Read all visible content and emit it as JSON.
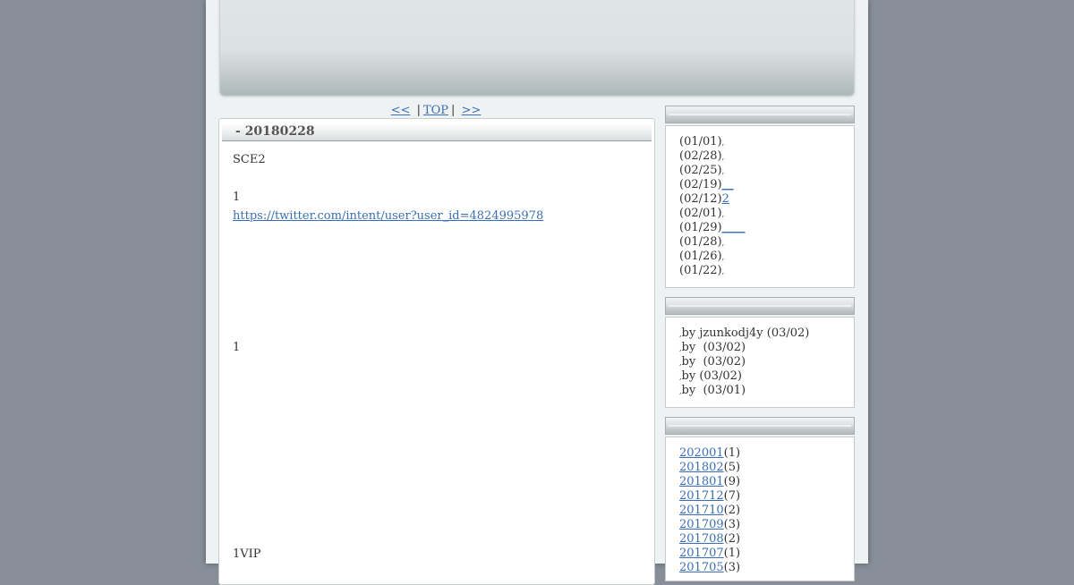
{
  "nav": {
    "prev": "<<",
    "top": "TOP",
    "next": ">>",
    "sep": "|"
  },
  "entry": {
    "title": "- 20180228",
    "lines": [
      "SCE2",
      "1",
      "https://twitter.com/intent/user?user_id=4824995978",
      "1",
      "1VIP"
    ]
  },
  "recent_entries": [
    {
      "date": "(01/01)",
      "suffix": ",",
      "link": ""
    },
    {
      "date": "(02/28)",
      "suffix": ",",
      "link": ""
    },
    {
      "date": "(02/25)",
      "suffix": ",",
      "link": ""
    },
    {
      "date": "(02/19)",
      "suffix": "",
      "link": "__"
    },
    {
      "date": "(02/12)",
      "suffix": "",
      "link": "2"
    },
    {
      "date": "(02/01)",
      "suffix": ",",
      "link": ""
    },
    {
      "date": "(01/29)",
      "suffix": "",
      "link": "____"
    },
    {
      "date": "(01/28)",
      "suffix": ",",
      "link": ""
    },
    {
      "date": "(01/26)",
      "suffix": ",",
      "link": ""
    },
    {
      "date": "(01/22)",
      "suffix": ",",
      "link": ""
    }
  ],
  "recent_comments": [
    {
      "prefix": ",",
      "text": "by jzunkodj4y (03/02)"
    },
    {
      "prefix": ",",
      "text": "by  (03/02)"
    },
    {
      "prefix": ",",
      "text": "by  (03/02)"
    },
    {
      "prefix": ",",
      "text": "by (03/02)"
    },
    {
      "prefix": ",",
      "text": "by  (03/01)"
    }
  ],
  "archives": [
    {
      "month": "202001",
      "count": "(1)"
    },
    {
      "month": "201802",
      "count": "(5)"
    },
    {
      "month": "201801",
      "count": "(9)"
    },
    {
      "month": "201712",
      "count": "(7)"
    },
    {
      "month": "201710",
      "count": "(2)"
    },
    {
      "month": "201709",
      "count": "(3)"
    },
    {
      "month": "201708",
      "count": "(2)"
    },
    {
      "month": "201707",
      "count": "(1)"
    },
    {
      "month": "201705",
      "count": "(3)"
    }
  ]
}
